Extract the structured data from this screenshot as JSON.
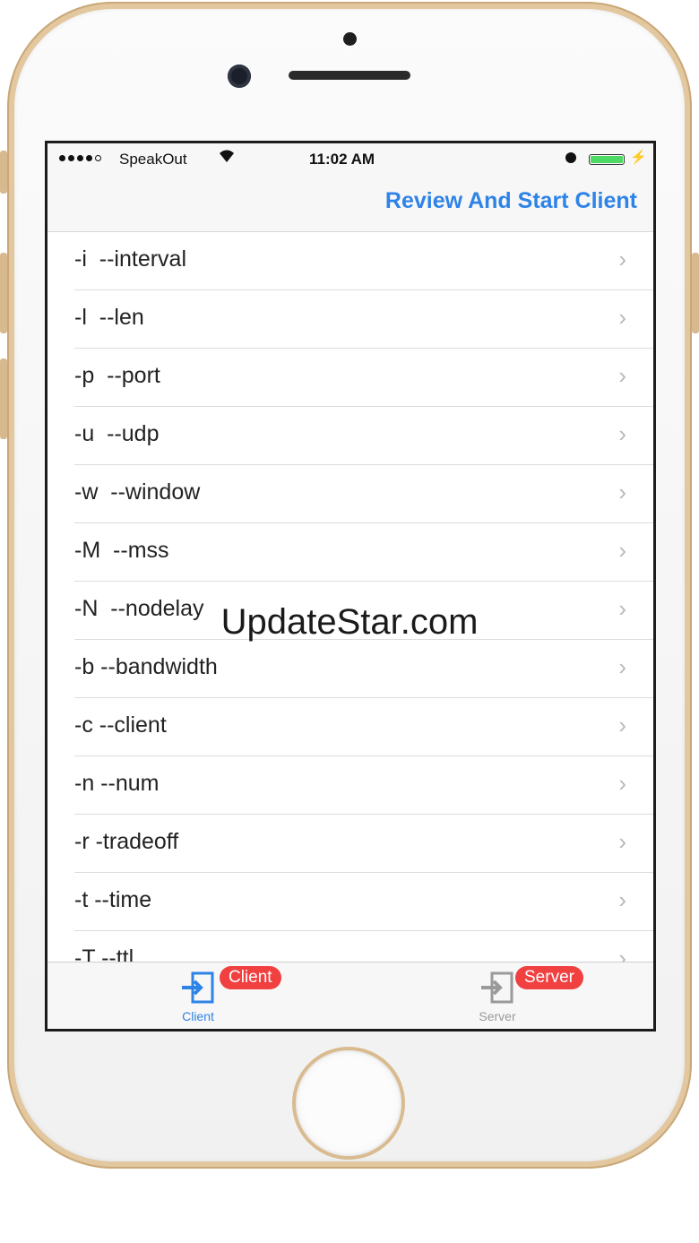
{
  "status_bar": {
    "carrier": "SpeakOut",
    "time": "11:02 AM"
  },
  "nav_bar": {
    "action_label": "Review And Start Client"
  },
  "list": {
    "items": [
      {
        "label": "-i  --interval"
      },
      {
        "label": "-l  --len"
      },
      {
        "label": "-p  --port"
      },
      {
        "label": "-u  --udp"
      },
      {
        "label": "-w  --window"
      },
      {
        "label": "-M  --mss"
      },
      {
        "label": "-N  --nodelay"
      },
      {
        "label": "-b --bandwidth"
      },
      {
        "label": "-c --client"
      },
      {
        "label": "-n --num"
      },
      {
        "label": "-r -tradeoff"
      },
      {
        "label": "-t --time"
      },
      {
        "label": "-T --ttl"
      }
    ]
  },
  "tab_bar": {
    "tabs": [
      {
        "label": "Client",
        "badge": "Client",
        "icon": "login-icon",
        "color": "#2e83e6",
        "selected": true
      },
      {
        "label": "Server",
        "badge": "Server",
        "icon": "login-icon",
        "color": "#9a9a9a",
        "selected": false
      }
    ]
  },
  "watermark": "UpdateStar.com",
  "colors": {
    "accent": "#2e83e6",
    "badge": "#f14040",
    "battery": "#4cd964",
    "phone_frame": "#e2c79f"
  }
}
